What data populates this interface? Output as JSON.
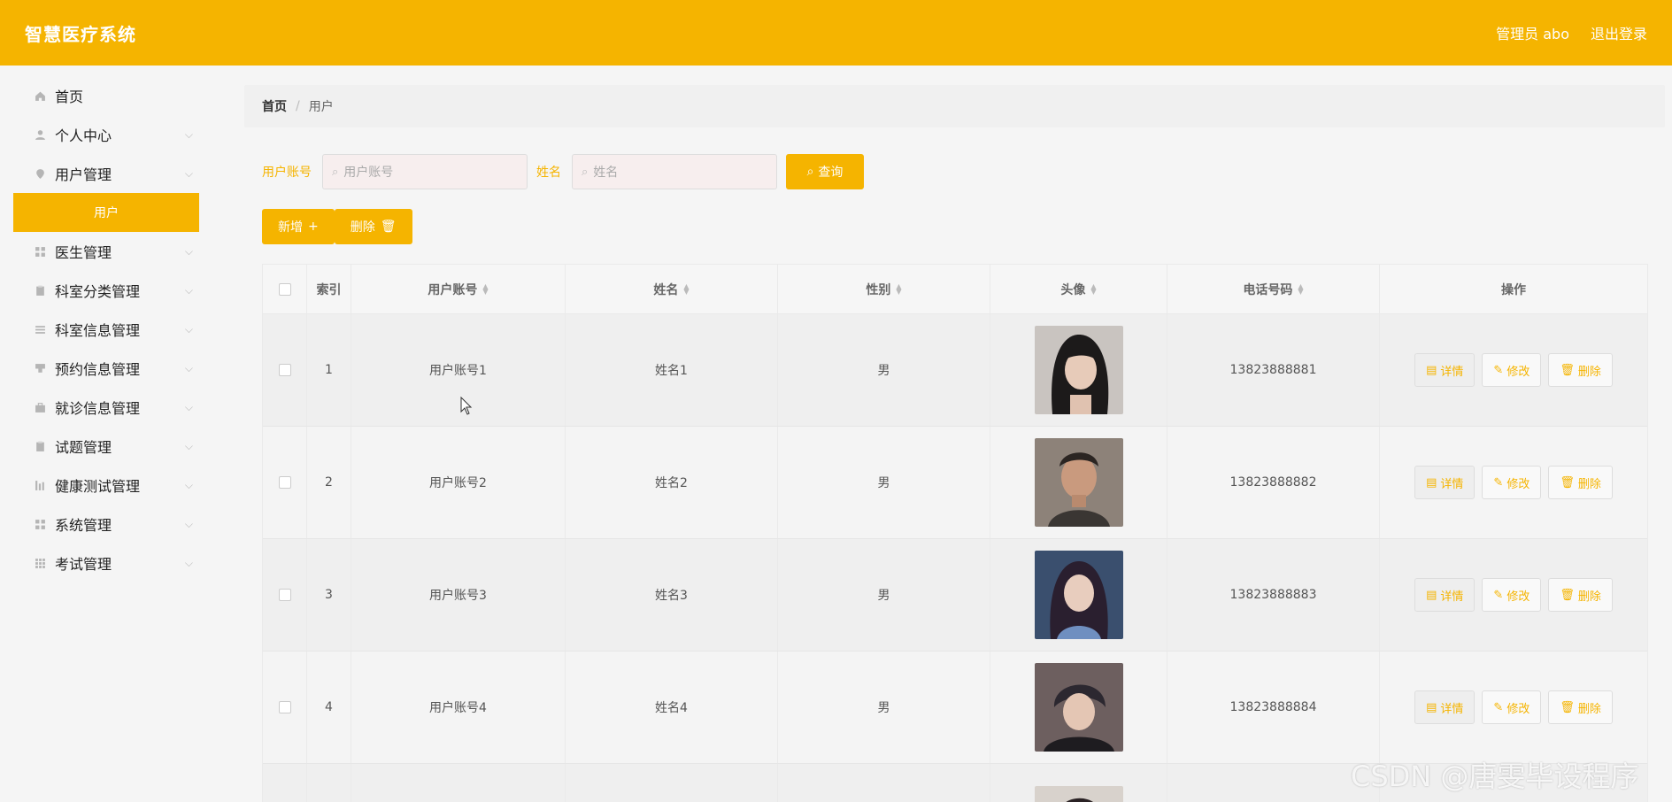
{
  "header": {
    "title": "智慧医疗系统",
    "admin_label": "管理员 abo",
    "logout_label": "退出登录"
  },
  "sidebar": {
    "items": [
      {
        "label": "首页",
        "icon": "home-icon"
      },
      {
        "label": "个人中心",
        "icon": "user-icon"
      },
      {
        "label": "用户管理",
        "icon": "pin-icon"
      },
      {
        "label": "医生管理",
        "icon": "grid-icon"
      },
      {
        "label": "科室分类管理",
        "icon": "clipboard-icon"
      },
      {
        "label": "科室信息管理",
        "icon": "list-icon"
      },
      {
        "label": "预约信息管理",
        "icon": "stamp-icon"
      },
      {
        "label": "就诊信息管理",
        "icon": "briefcase-icon"
      },
      {
        "label": "试题管理",
        "icon": "clipboard-icon"
      },
      {
        "label": "健康测试管理",
        "icon": "chart-icon"
      },
      {
        "label": "系统管理",
        "icon": "grid-icon"
      },
      {
        "label": "考试管理",
        "icon": "grid9-icon"
      }
    ],
    "active_sub": "用户"
  },
  "breadcrumb": {
    "home": "首页",
    "current": "用户"
  },
  "search": {
    "account_label": "用户账号",
    "account_placeholder": "用户账号",
    "name_label": "姓名",
    "name_placeholder": "姓名",
    "query_label": "查询"
  },
  "actions": {
    "add_label": "新增",
    "delete_label": "删除"
  },
  "table": {
    "headers": {
      "index": "索引",
      "account": "用户账号",
      "name": "姓名",
      "gender": "性别",
      "avatar": "头像",
      "phone": "电话号码",
      "operation": "操作"
    },
    "rows": [
      {
        "index": "1",
        "account": "用户账号1",
        "name": "姓名1",
        "gender": "男",
        "phone": "13823888881"
      },
      {
        "index": "2",
        "account": "用户账号2",
        "name": "姓名2",
        "gender": "男",
        "phone": "13823888882"
      },
      {
        "index": "3",
        "account": "用户账号3",
        "name": "姓名3",
        "gender": "男",
        "phone": "13823888883"
      },
      {
        "index": "4",
        "account": "用户账号4",
        "name": "姓名4",
        "gender": "男",
        "phone": "13823888884"
      }
    ],
    "op_labels": {
      "detail": "详情",
      "edit": "修改",
      "delete": "删除"
    }
  },
  "watermark": "CSDN @唐雯毕设程序",
  "colors": {
    "accent": "#f5b400",
    "bg": "#f5f5f5"
  }
}
